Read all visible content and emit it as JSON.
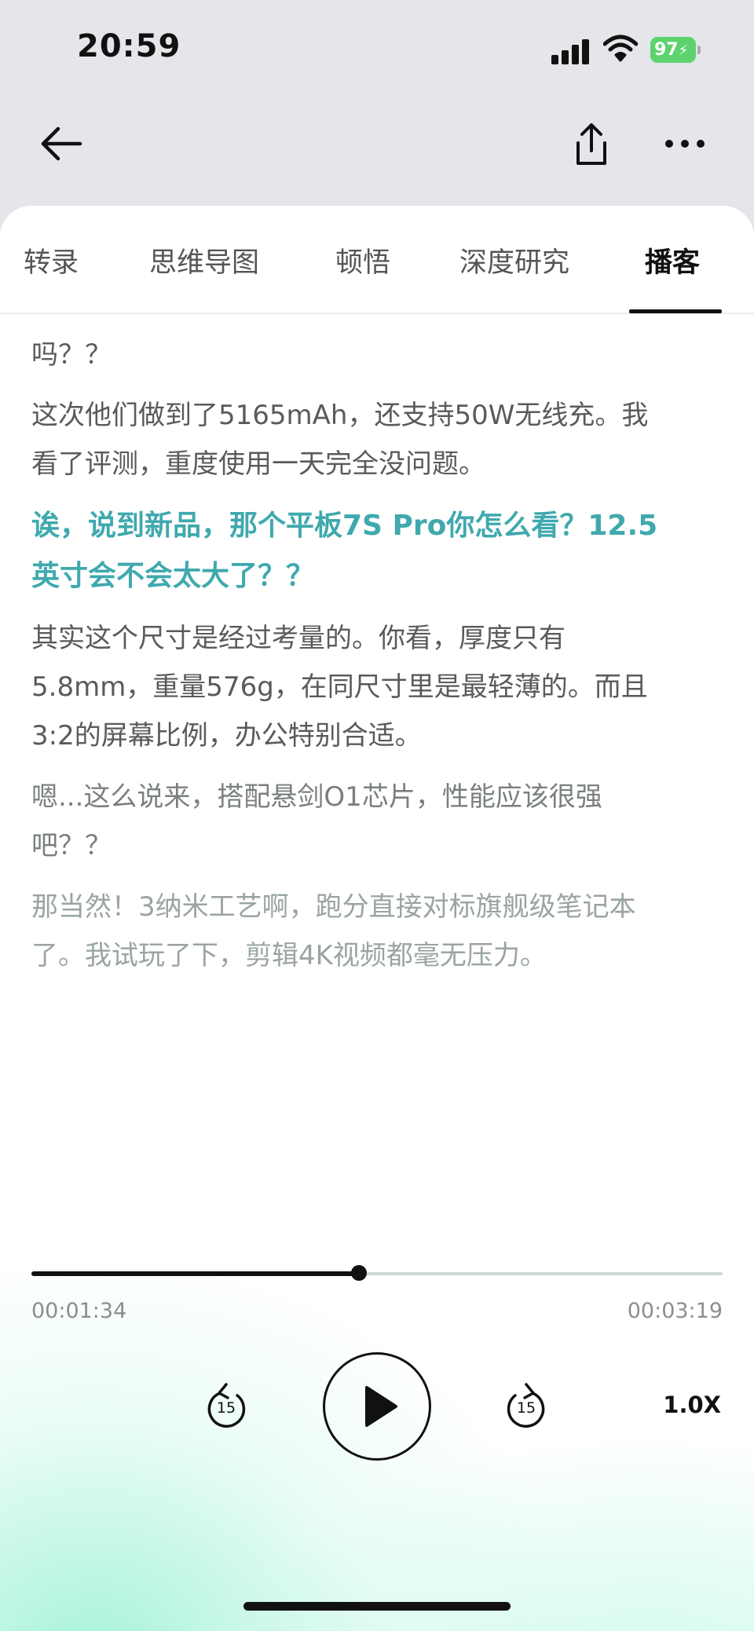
{
  "status_bar": {
    "time": "20:59",
    "battery_level": "97",
    "icons": [
      "signal-icon",
      "wifi-icon",
      "battery-charging-icon"
    ]
  },
  "nav": {
    "icons": [
      "back-arrow-icon",
      "share-icon",
      "more-icon"
    ]
  },
  "tabs": [
    {
      "label": "转录",
      "active": false
    },
    {
      "label": "思维导图",
      "active": false
    },
    {
      "label": "顿悟",
      "active": false
    },
    {
      "label": "深度研究",
      "active": false
    },
    {
      "label": "播客",
      "active": true
    }
  ],
  "transcript": [
    {
      "speaker": "host",
      "text": "吗？？"
    },
    {
      "speaker": "guest",
      "text": "这次他们做到了5165mAh，还支持50W无线充。我看了评测，重度使用一天完全没问题。"
    },
    {
      "speaker": "host",
      "text": "诶，说到新品，那个平板7S Pro你怎么看？12.5英寸会不会太大了？？"
    },
    {
      "speaker": "guest",
      "text": "其实这个尺寸是经过考量的。你看，厚度只有5.8mm，重量576g，在同尺寸里是最轻薄的。而且3:2的屏幕比例，办公特别合适。"
    },
    {
      "speaker": "host",
      "text": "嗯...这么说来，搭配悬剑O1芯片，性能应该很强吧？？"
    },
    {
      "speaker": "guest",
      "text": "那当然！3纳米工艺啊，跑分直接对标旗舰级笔记本了。我试玩了下，剪辑4K视频都毫无压力。"
    }
  ],
  "player": {
    "current_time": "00:01:34",
    "total_time": "00:03:19",
    "progress": 0.474,
    "rewind_label": "15",
    "forward_label": "15",
    "speed_label": "1.0X",
    "state": "paused"
  },
  "colors": {
    "accent_question": "#3fa9ae",
    "body_text": "#5a5a5a",
    "battery_green": "#5dd36f",
    "background_gradient": "#aaf0d8"
  }
}
